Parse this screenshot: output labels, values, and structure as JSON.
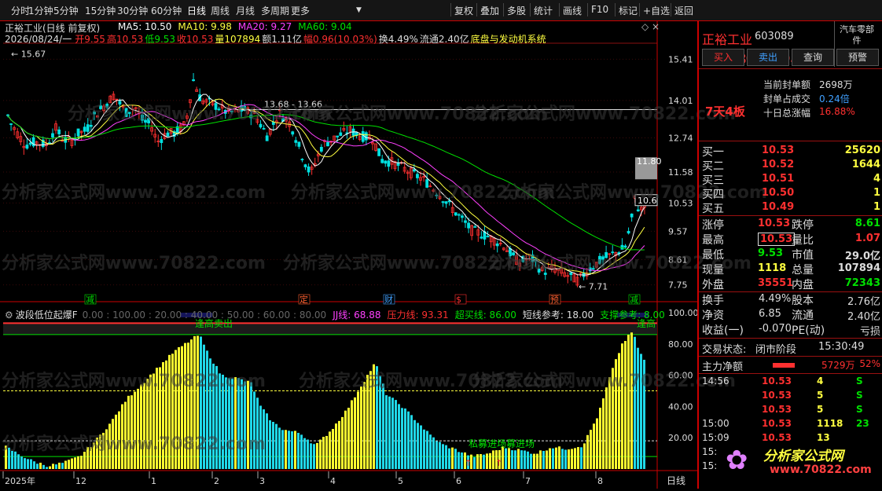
{
  "toolbar": {
    "left": [
      "分时",
      "1分钟",
      "5分钟",
      "15分钟",
      "30分钟",
      "60分钟",
      "日线",
      "周线",
      "月线",
      "多周期",
      "更多"
    ],
    "right": [
      "复权",
      "叠加",
      "多股",
      "统计",
      "画线",
      "F10",
      "标记",
      "+自选",
      "返回"
    ],
    "active": "日线"
  },
  "main": {
    "title": "正裕工业(日线 前复权)",
    "ma_labels": [
      "MA5: 10.50",
      "MA10: 9.98",
      "MA20: 9.27",
      "MA60: 9.04"
    ],
    "ma_colors": [
      "#ffffff",
      "#ffff40",
      "#ff40ff",
      "#00e000"
    ],
    "info_date": "2026/08/24/一",
    "info_items": [
      "开9.55",
      "高10.53",
      "低9.53",
      "收10.53",
      "量107894",
      "额1.11亿",
      "幅0.96(10.03%)",
      "换4.49%",
      "流通2.40亿",
      "底盘与发动机系统"
    ],
    "price_ticks": [
      "15.41",
      "14.01",
      "12.74",
      "11.58",
      "10.53",
      "9.57",
      "8.61",
      "7.75"
    ],
    "annotation_high": "15.67",
    "annotation_range": "13.68 - 13.66",
    "annotation_low": "7.71",
    "last_box_top": "11.80",
    "last_box_mid": "10.6",
    "event_markers": [
      {
        "t": "减",
        "c": "#00e000"
      },
      {
        "t": "定",
        "c": "#ff6030"
      },
      {
        "t": "财",
        "c": "#40a0ff"
      },
      {
        "t": "$",
        "c": "#ff3030"
      },
      {
        "t": "预",
        "c": "#ff6030"
      },
      {
        "t": "减",
        "c": "#00e000"
      }
    ]
  },
  "indicator": {
    "title": "波段低位起爆F",
    "levels": "0.00 : 100.00 : 20.00 : 40.00 : 50.00 : 60.00 : 80.00",
    "jj": "JJ线: 68.88",
    "yali": "压力线: 93.31",
    "chaomai": "超买线: 86.00",
    "duanxian": "短线参考: 18.00",
    "zhicheng": "支撑参考: 8.00",
    "ticks": [
      "100.00",
      "80.00",
      "60.00",
      "40.00",
      "20.00"
    ],
    "sell1": "逢高卖出",
    "sell2": "逢高",
    "buy_label": "私募进场募进场"
  },
  "xaxis": {
    "labels": [
      "2025年",
      "12",
      "1",
      "2",
      "3",
      "4",
      "5",
      "6",
      "7",
      "8"
    ],
    "period": "日线"
  },
  "watermark": "分析家公式网www.70822.com",
  "right": {
    "name": "正裕工业",
    "code": "603089",
    "price": "10.53",
    "change": "0.96",
    "pct": "10.03%",
    "sector": "汽车零部件",
    "sector_pct": "-1.16%",
    "buttons": [
      "买入",
      "卖出",
      "查询",
      "预警"
    ],
    "seal_label": "当前封单额",
    "seal_val": "2698万",
    "seal_ratio_label": "封单占成交",
    "seal_ratio_val": "0.24倍",
    "ten_day_label": "十日总涨幅",
    "ten_day_val": "16.88%",
    "streak": "7天4板",
    "bids": [
      {
        "l": "买一",
        "p": "10.53",
        "v": "25620"
      },
      {
        "l": "买二",
        "p": "10.52",
        "v": "1644"
      },
      {
        "l": "买三",
        "p": "10.51",
        "v": "4"
      },
      {
        "l": "买四",
        "p": "10.50",
        "v": "1"
      },
      {
        "l": "买五",
        "p": "10.49",
        "v": "1"
      }
    ],
    "stats1": [
      {
        "l": "涨停",
        "v": "10.53",
        "c": "#ff3030",
        "l2": "跌停",
        "v2": "8.61",
        "c2": "#00e000"
      },
      {
        "l": "最高",
        "v": "10.53",
        "c": "#ff3030",
        "l2": "量比",
        "v2": "1.07",
        "c2": "#ff3030"
      },
      {
        "l": "最低",
        "v": "9.53",
        "c": "#00e000",
        "l2": "市值",
        "v2": "29.0亿",
        "c2": "#dddddd"
      },
      {
        "l": "现量",
        "v": "1118",
        "c": "#ffff40",
        "l2": "总量",
        "v2": "107894",
        "c2": "#dddddd"
      },
      {
        "l": "外盘",
        "v": "35551",
        "c": "#ff3030",
        "l2": "内盘",
        "v2": "72343",
        "c2": "#00e000"
      }
    ],
    "stats2": [
      {
        "l": "换手",
        "v": "4.49%",
        "l2": "股本",
        "v2": "2.76亿"
      },
      {
        "l": "净资",
        "v": "6.85",
        "l2": "流通",
        "v2": "2.40亿"
      },
      {
        "l": "收益(一)",
        "v": "-0.070",
        "l2": "PE(动)",
        "v2": "亏损"
      }
    ],
    "status_label": "交易状态:",
    "status_val": "闭市阶段",
    "status_time": "15:30:49",
    "mainflow_label": "主力净额",
    "mainflow_val": "5729万",
    "mainflow_pct": "52%",
    "ticks": [
      {
        "t": "14:56",
        "p": "10.53",
        "v": "4",
        "d": "S"
      },
      {
        "t": "",
        "p": "10.53",
        "v": "5",
        "d": "S"
      },
      {
        "t": "",
        "p": "10.53",
        "v": "5",
        "d": "S"
      },
      {
        "t": "15:00",
        "p": "10.53",
        "v": "1118",
        "d": "23"
      },
      {
        "t": "15:09",
        "p": "10.53",
        "v": "13",
        "d": ""
      },
      {
        "t": "15:",
        "p": "",
        "v": "",
        "d": ""
      },
      {
        "t": "15:",
        "p": "",
        "v": "",
        "d": ""
      }
    ],
    "logo_text": "分析家公式网",
    "logo_url": "www.70822.com"
  }
}
